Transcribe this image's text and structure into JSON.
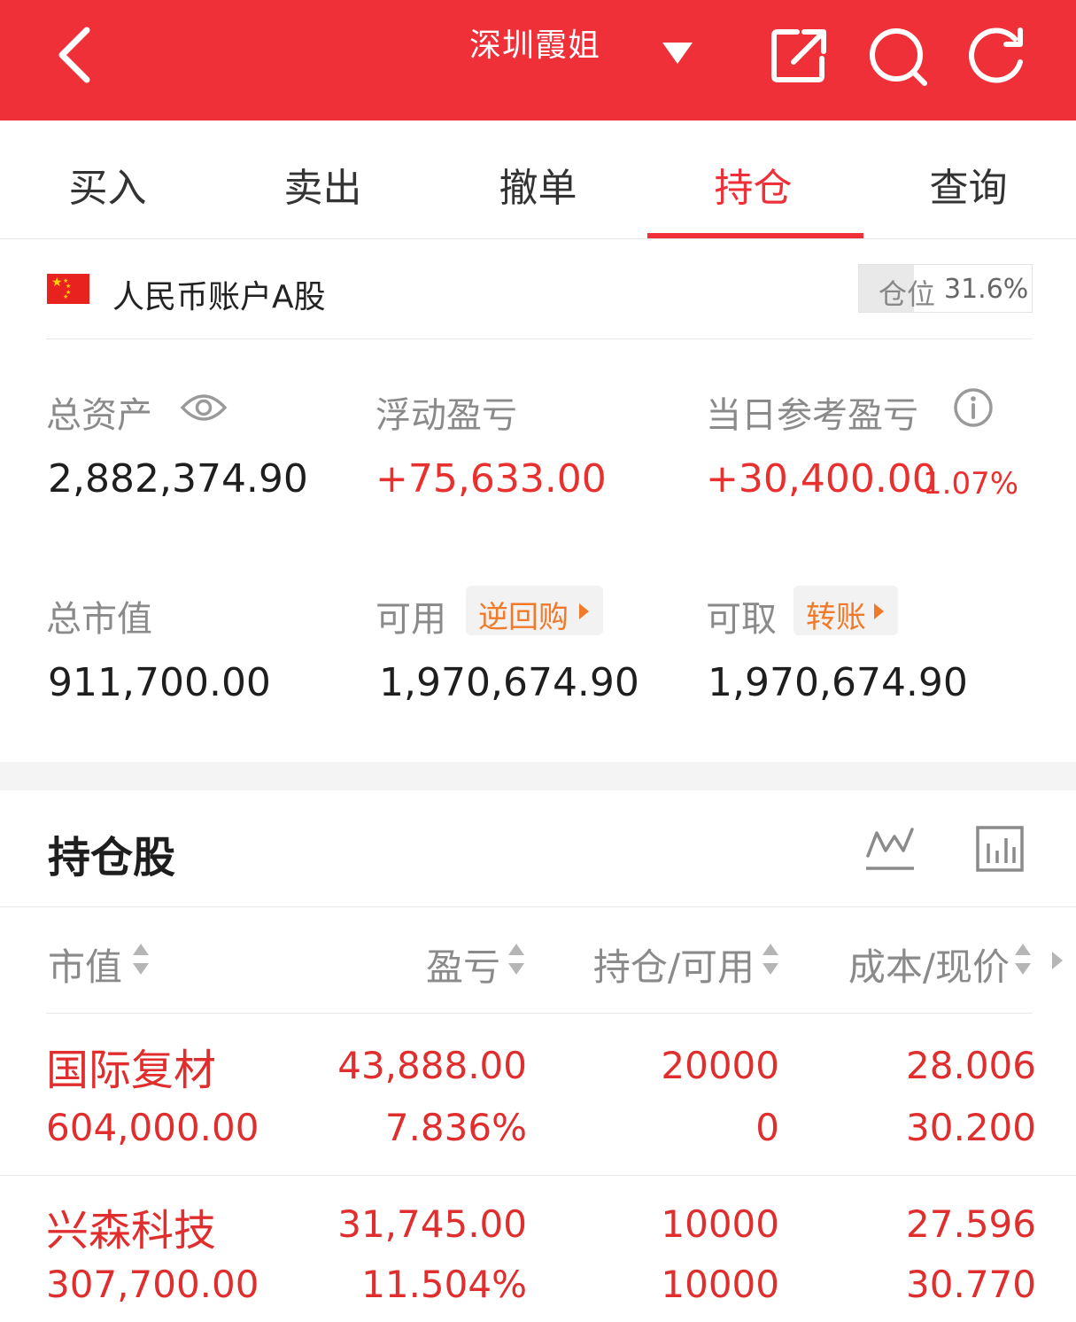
{
  "header": {
    "title": "深圳霞姐"
  },
  "tabs": [
    "买入",
    "卖出",
    "撤单",
    "持仓",
    "查询"
  ],
  "active_tab": "持仓",
  "account": {
    "name": "人民币账户A股",
    "position_label": "仓位",
    "position_value": "31.6%"
  },
  "summary": {
    "total_assets_label": "总资产",
    "total_assets": "2,882,374.90",
    "float_pnl_label": "浮动盈亏",
    "float_pnl": "+75,633.00",
    "daily_pnl_label": "当日参考盈亏",
    "daily_pnl": "+30,400.00",
    "daily_pnl_pct": "1.07%",
    "market_value_label": "总市值",
    "market_value": "911,700.00",
    "available_label": "可用",
    "available_chip": "逆回购",
    "available": "1,970,674.90",
    "withdrawable_label": "可取",
    "withdrawable_chip": "转账",
    "withdrawable": "1,970,674.90"
  },
  "holdings": {
    "title": "持仓股",
    "columns": [
      "市值",
      "盈亏",
      "持仓/可用",
      "成本/现价"
    ],
    "rows": [
      {
        "name": "国际复材",
        "market_value": "604,000.00",
        "pnl": "43,888.00",
        "pnl_pct": "7.836%",
        "position": "20000",
        "available": "0",
        "cost": "28.006",
        "price": "30.200"
      },
      {
        "name": "兴森科技",
        "market_value": "307,700.00",
        "pnl": "31,745.00",
        "pnl_pct": "11.504%",
        "position": "10000",
        "available": "10000",
        "cost": "27.596",
        "price": "30.770"
      }
    ]
  },
  "colors": {
    "brand_red": "#ef3039",
    "profit_red": "#e02e2e",
    "chip_orange": "#f07a2a"
  },
  "icons": [
    "back-icon",
    "dropdown-icon",
    "share-icon",
    "search-icon",
    "refresh-icon",
    "eye-icon",
    "info-icon",
    "line-chart-icon",
    "bar-chart-icon"
  ]
}
